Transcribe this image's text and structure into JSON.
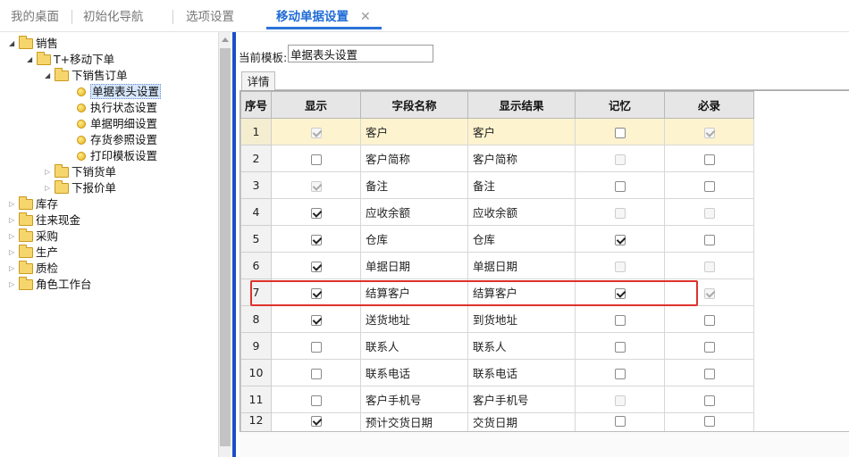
{
  "tabs": [
    {
      "label": "我的桌面"
    },
    {
      "label": "初始化导航"
    },
    {
      "label": "选项设置"
    },
    {
      "label": "移动单据设置"
    }
  ],
  "tab_close_glyph": "✕",
  "tree": {
    "sales": "销售",
    "t_mobile_order": "T+移动下单",
    "sales_order": "下销售订单",
    "leaves": [
      "单据表头设置",
      "执行状态设置",
      "单据明细设置",
      "存货参照设置",
      "打印模板设置"
    ],
    "delivery": "下销货单",
    "quote": "下报价单",
    "roots": [
      "库存",
      "往来现金",
      "采购",
      "生产",
      "质检",
      "角色工作台"
    ]
  },
  "form": {
    "template_label": "当前模板:",
    "template_value": "单据表头设置",
    "detail_tab": "详情"
  },
  "grid": {
    "columns": [
      "序号",
      "显示",
      "字段名称",
      "显示结果",
      "记忆",
      "必录"
    ],
    "rows": [
      {
        "no": "1",
        "show": "on-dis",
        "field": "客户",
        "result": "客户",
        "memory": "off",
        "required": "on-dis"
      },
      {
        "no": "2",
        "show": "off",
        "field": "客户简称",
        "result": "客户简称",
        "memory": "off-dis",
        "required": "off"
      },
      {
        "no": "3",
        "show": "on-dis",
        "field": "备注",
        "result": "备注",
        "memory": "off",
        "required": "off"
      },
      {
        "no": "4",
        "show": "on",
        "field": "应收余额",
        "result": "应收余额",
        "memory": "off-dis",
        "required": "off-dis"
      },
      {
        "no": "5",
        "show": "on",
        "field": "仓库",
        "result": "仓库",
        "memory": "on",
        "required": "off"
      },
      {
        "no": "6",
        "show": "on",
        "field": "单据日期",
        "result": "单据日期",
        "memory": "off-dis",
        "required": "off-dis"
      },
      {
        "no": "7",
        "show": "on",
        "field": "结算客户",
        "result": "结算客户",
        "memory": "on",
        "required": "on-dis"
      },
      {
        "no": "8",
        "show": "on",
        "field": "送货地址",
        "result": "到货地址",
        "memory": "off",
        "required": "off"
      },
      {
        "no": "9",
        "show": "off",
        "field": "联系人",
        "result": "联系人",
        "memory": "off",
        "required": "off"
      },
      {
        "no": "10",
        "show": "off",
        "field": "联系电话",
        "result": "联系电话",
        "memory": "off",
        "required": "off"
      },
      {
        "no": "11",
        "show": "off",
        "field": "客户手机号",
        "result": "客户手机号",
        "memory": "off-dis",
        "required": "off"
      },
      {
        "no": "12",
        "show": "on",
        "field": "预计交货日期",
        "result": "交货日期",
        "memory": "off",
        "required": "off"
      }
    ]
  },
  "colors": {
    "accent": "#1f6bd6",
    "highlight_row": "#fdf3cf",
    "annotation_box": "#e0312b"
  }
}
